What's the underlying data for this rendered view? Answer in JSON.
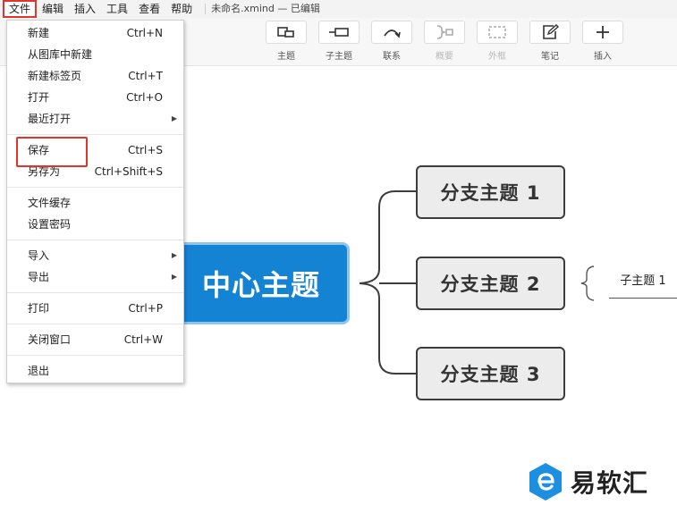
{
  "menubar": {
    "items": [
      "文件",
      "编辑",
      "插入",
      "工具",
      "查看",
      "帮助"
    ],
    "title": "未命名.xmind — 已编辑"
  },
  "toolbar": {
    "buttons": [
      {
        "label": "主题",
        "icon": "topic-icon",
        "enabled": true
      },
      {
        "label": "子主题",
        "icon": "subtopic-icon",
        "enabled": true
      },
      {
        "label": "联系",
        "icon": "relationship-icon",
        "enabled": true
      },
      {
        "label": "概要",
        "icon": "summary-icon",
        "enabled": false
      },
      {
        "label": "外框",
        "icon": "boundary-icon",
        "enabled": false
      },
      {
        "label": "笔记",
        "icon": "note-icon",
        "enabled": true
      },
      {
        "label": "插入",
        "icon": "plus-icon",
        "enabled": true
      }
    ]
  },
  "file_menu": {
    "items": [
      {
        "label": "新建",
        "shortcut": "Ctrl+N"
      },
      {
        "label": "从图库中新建",
        "shortcut": ""
      },
      {
        "label": "新建标签页",
        "shortcut": "Ctrl+T"
      },
      {
        "label": "打开",
        "shortcut": "Ctrl+O"
      },
      {
        "label": "最近打开",
        "shortcut": "",
        "submenu": true
      },
      {
        "label": "保存",
        "shortcut": "Ctrl+S",
        "highlighted": true
      },
      {
        "label": "另存为",
        "shortcut": "Ctrl+Shift+S"
      },
      {
        "label": "文件缓存",
        "shortcut": ""
      },
      {
        "label": "设置密码",
        "shortcut": ""
      },
      {
        "label": "导入",
        "shortcut": "",
        "submenu": true
      },
      {
        "label": "导出",
        "shortcut": "",
        "submenu": true
      },
      {
        "label": "打印",
        "shortcut": "Ctrl+P"
      },
      {
        "label": "关闭窗口",
        "shortcut": "Ctrl+W"
      },
      {
        "label": "退出",
        "shortcut": ""
      }
    ]
  },
  "mindmap": {
    "central": "中心主题",
    "branches": [
      "分支主题 1",
      "分支主题 2",
      "分支主题 3"
    ],
    "subtopic": "子主题 1"
  },
  "watermark": {
    "text": "易软汇"
  },
  "colors": {
    "central": "#1583d4",
    "highlight": "#e0342d",
    "logo": "#1c8fe0"
  }
}
